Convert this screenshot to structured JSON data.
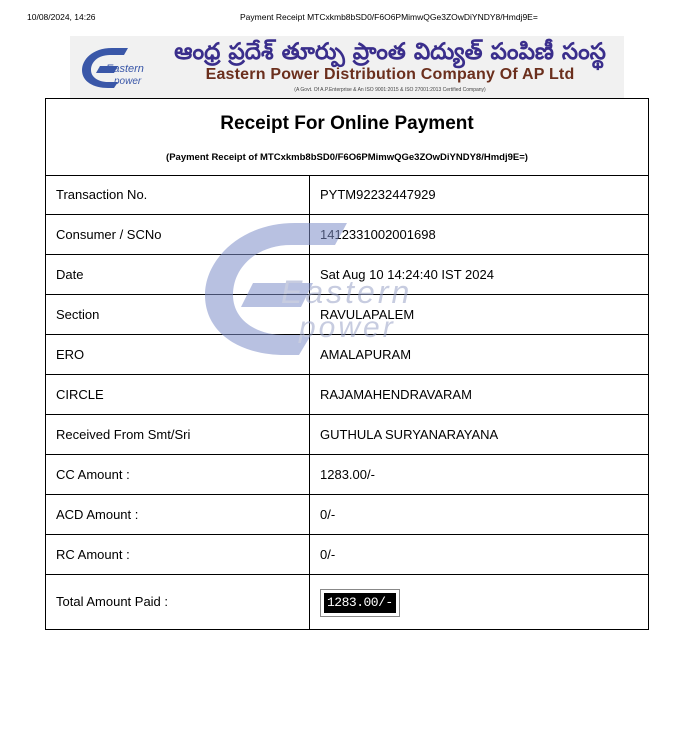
{
  "print_header": {
    "datetime": "10/08/2024, 14:26",
    "title": "Payment Receipt MTCxkmb8bSD0/F6O6PMimwQGe3ZOwDiYNDY8/Hmdj9E="
  },
  "banner": {
    "logo_text_1": "Eastern",
    "logo_text_2": "power",
    "telugu_name": "ఆంధ్ర ప్రదేశ్ తూర్పు ప్రాంత విద్యుత్ పంపిణీ సంస్థ",
    "english_name": "Eastern Power Distribution Company Of AP Ltd",
    "subtitle": "(A Govt. Of A.P.Enterprise & An ISO 9001:2015 & ISO 27001:2013 Certified Company)"
  },
  "receipt": {
    "title": "Receipt For Online Payment",
    "subtitle": "(Payment Receipt of MTCxkmb8bSD0/F6O6PMimwQGe3ZOwDiYNDY8/Hmdj9E=)",
    "rows": [
      {
        "label": "Transaction No.",
        "value": "PYTM92232447929"
      },
      {
        "label": "Consumer / SCNo",
        "value": "1412331002001698"
      },
      {
        "label": "Date",
        "value": "Sat Aug 10 14:24:40 IST 2024"
      },
      {
        "label": "Section",
        "value": "RAVULAPALEM"
      },
      {
        "label": "ERO",
        "value": "AMALAPURAM"
      },
      {
        "label": "CIRCLE",
        "value": "RAJAMAHENDRAVARAM"
      },
      {
        "label": "Received From Smt/Sri",
        "value": "GUTHULA SURYANARAYANA"
      },
      {
        "label": "CC Amount :",
        "value": "1283.00/-"
      },
      {
        "label": "ACD Amount :",
        "value": "0/-"
      },
      {
        "label": "RC Amount :",
        "value": "0/-"
      },
      {
        "label": "Total Amount Paid :",
        "value": "1283.00/-"
      }
    ]
  },
  "watermark": {
    "text_1": "Eastern",
    "text_2": "power"
  },
  "colors": {
    "brand_blue": "#3a57a8",
    "brand_brown": "#6b2f1d",
    "telugu_text": "#3a2e8c"
  }
}
